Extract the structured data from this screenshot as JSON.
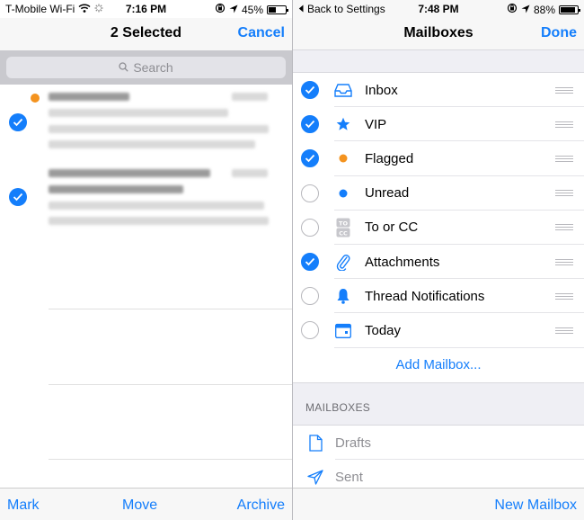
{
  "left": {
    "status": {
      "carrier": "T-Mobile Wi-Fi",
      "time": "7:16 PM",
      "battery": "45%",
      "battery_level": 0.45
    },
    "nav": {
      "title": "2 Selected",
      "cancel": "Cancel"
    },
    "search": {
      "placeholder": "Search"
    },
    "toolbar": {
      "mark": "Mark",
      "move": "Move",
      "archive": "Archive"
    }
  },
  "right": {
    "status": {
      "back": "Back to Settings",
      "time": "7:48 PM",
      "battery": "88%",
      "battery_level": 0.88
    },
    "nav": {
      "title": "Mailboxes",
      "done": "Done"
    },
    "rows": [
      {
        "label": "Inbox",
        "checked": true,
        "icon": "inbox-icon"
      },
      {
        "label": "VIP",
        "checked": true,
        "icon": "star-icon"
      },
      {
        "label": "Flagged",
        "checked": true,
        "icon": "orange-dot-icon"
      },
      {
        "label": "Unread",
        "checked": false,
        "icon": "blue-dot-icon"
      },
      {
        "label": "To or CC",
        "checked": false,
        "icon": "to-cc-icon"
      },
      {
        "label": "Attachments",
        "checked": true,
        "icon": "paperclip-icon"
      },
      {
        "label": "Thread Notifications",
        "checked": false,
        "icon": "bell-icon"
      },
      {
        "label": "Today",
        "checked": false,
        "icon": "calendar-icon"
      }
    ],
    "add_mailbox": "Add Mailbox...",
    "section_header": "MAILBOXES",
    "mailboxes": [
      {
        "label": "Drafts",
        "icon": "document-icon"
      },
      {
        "label": "Sent",
        "icon": "paper-plane-icon"
      }
    ],
    "toolbar": {
      "new_mailbox": "New Mailbox"
    }
  },
  "colors": {
    "accent": "#147efb",
    "unread": "#f4931f"
  }
}
